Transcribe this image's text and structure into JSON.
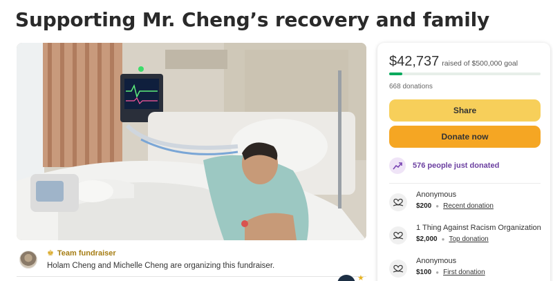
{
  "page": {
    "title": "Supporting Mr. Cheng’s recovery and family"
  },
  "organizer": {
    "badge": "Team fundraiser",
    "text": "Holam Cheng and Michelle Cheng are organizing this fundraiser."
  },
  "donation_card": {
    "amount_raised": "$42,737",
    "goal_text": "raised of $500,000 goal",
    "progress_fraction": 0.085,
    "donation_count": "668 donations",
    "share_label": "Share",
    "donate_label": "Donate now",
    "recent_activity": "576 people just donated",
    "donors": [
      {
        "name": "Anonymous",
        "amount": "$200",
        "tag": "Recent donation"
      },
      {
        "name": "1 Thing Against Racism Organization",
        "amount": "$2,000",
        "tag": "Top donation"
      },
      {
        "name": "Anonymous",
        "amount": "$100",
        "tag": "First donation"
      }
    ]
  },
  "colors": {
    "progress": "#02a95c",
    "share_button": "#f7cf5a",
    "donate_button": "#f5a623",
    "trend_text": "#6b3fa0",
    "team_badge": "#a57c12"
  },
  "icons": {
    "team": "team-icon",
    "trend": "trending-up-icon",
    "donor": "heart-hands-icon"
  }
}
